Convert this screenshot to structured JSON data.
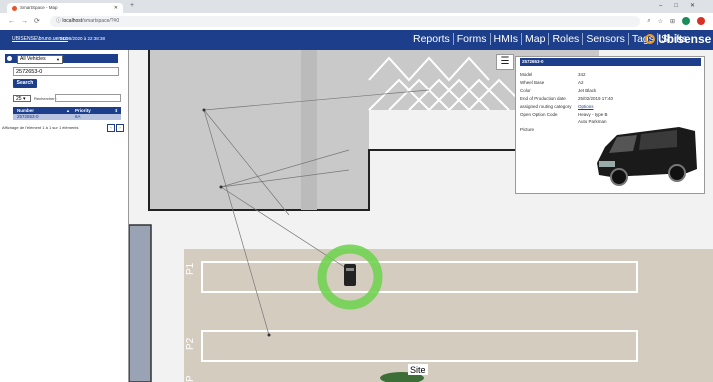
{
  "browser": {
    "tab_title": "SmartSpace - Map",
    "url_host": "localhost",
    "url_path": "/smartspace/?#0",
    "new_tab": "+",
    "close_tab": "✕"
  },
  "header": {
    "user": "UBISENSE\\bruno.uemco",
    "datetime": "31/08/2020 à 22:38:38",
    "menu": [
      "Reports",
      "Forms",
      "HMIs",
      "Map",
      "Roles",
      "Sensors",
      "Tags",
      "Shifts"
    ],
    "brand": "Ubisense",
    "brand_color": "#f29b22"
  },
  "left_panel": {
    "vehicle_select": "All Vehicles",
    "filter_value": "2572653-0",
    "search_label": "Search",
    "page_size": "25",
    "search_label_small": "Rechercher :",
    "columns": [
      "Number",
      "Priority"
    ],
    "rows": [
      [
        "2572653-0",
        "6A"
      ]
    ],
    "page_info": "Affichage de l'élément 1 à 1 sur 1 éléments"
  },
  "map": {
    "site_label": "Site",
    "parking_labels": [
      "P1",
      "P2",
      "P"
    ],
    "ring_color": "#6bd24a"
  },
  "popup": {
    "title": "2572653-0",
    "fields": [
      {
        "label": "Model",
        "value": "342"
      },
      {
        "label": "Wheel Base",
        "value": "A2"
      },
      {
        "label": "Color",
        "value": "Jet Black"
      },
      {
        "label": "End of Production date",
        "value": "25/02/2019 17:40"
      },
      {
        "label": "assigned routing category",
        "value": "Options"
      },
      {
        "label": "Open Option Code",
        "value": "Heavy - type B"
      },
      {
        "label": "",
        "value": "Auto Parkman"
      },
      {
        "label": "Picture",
        "value": ""
      }
    ]
  }
}
